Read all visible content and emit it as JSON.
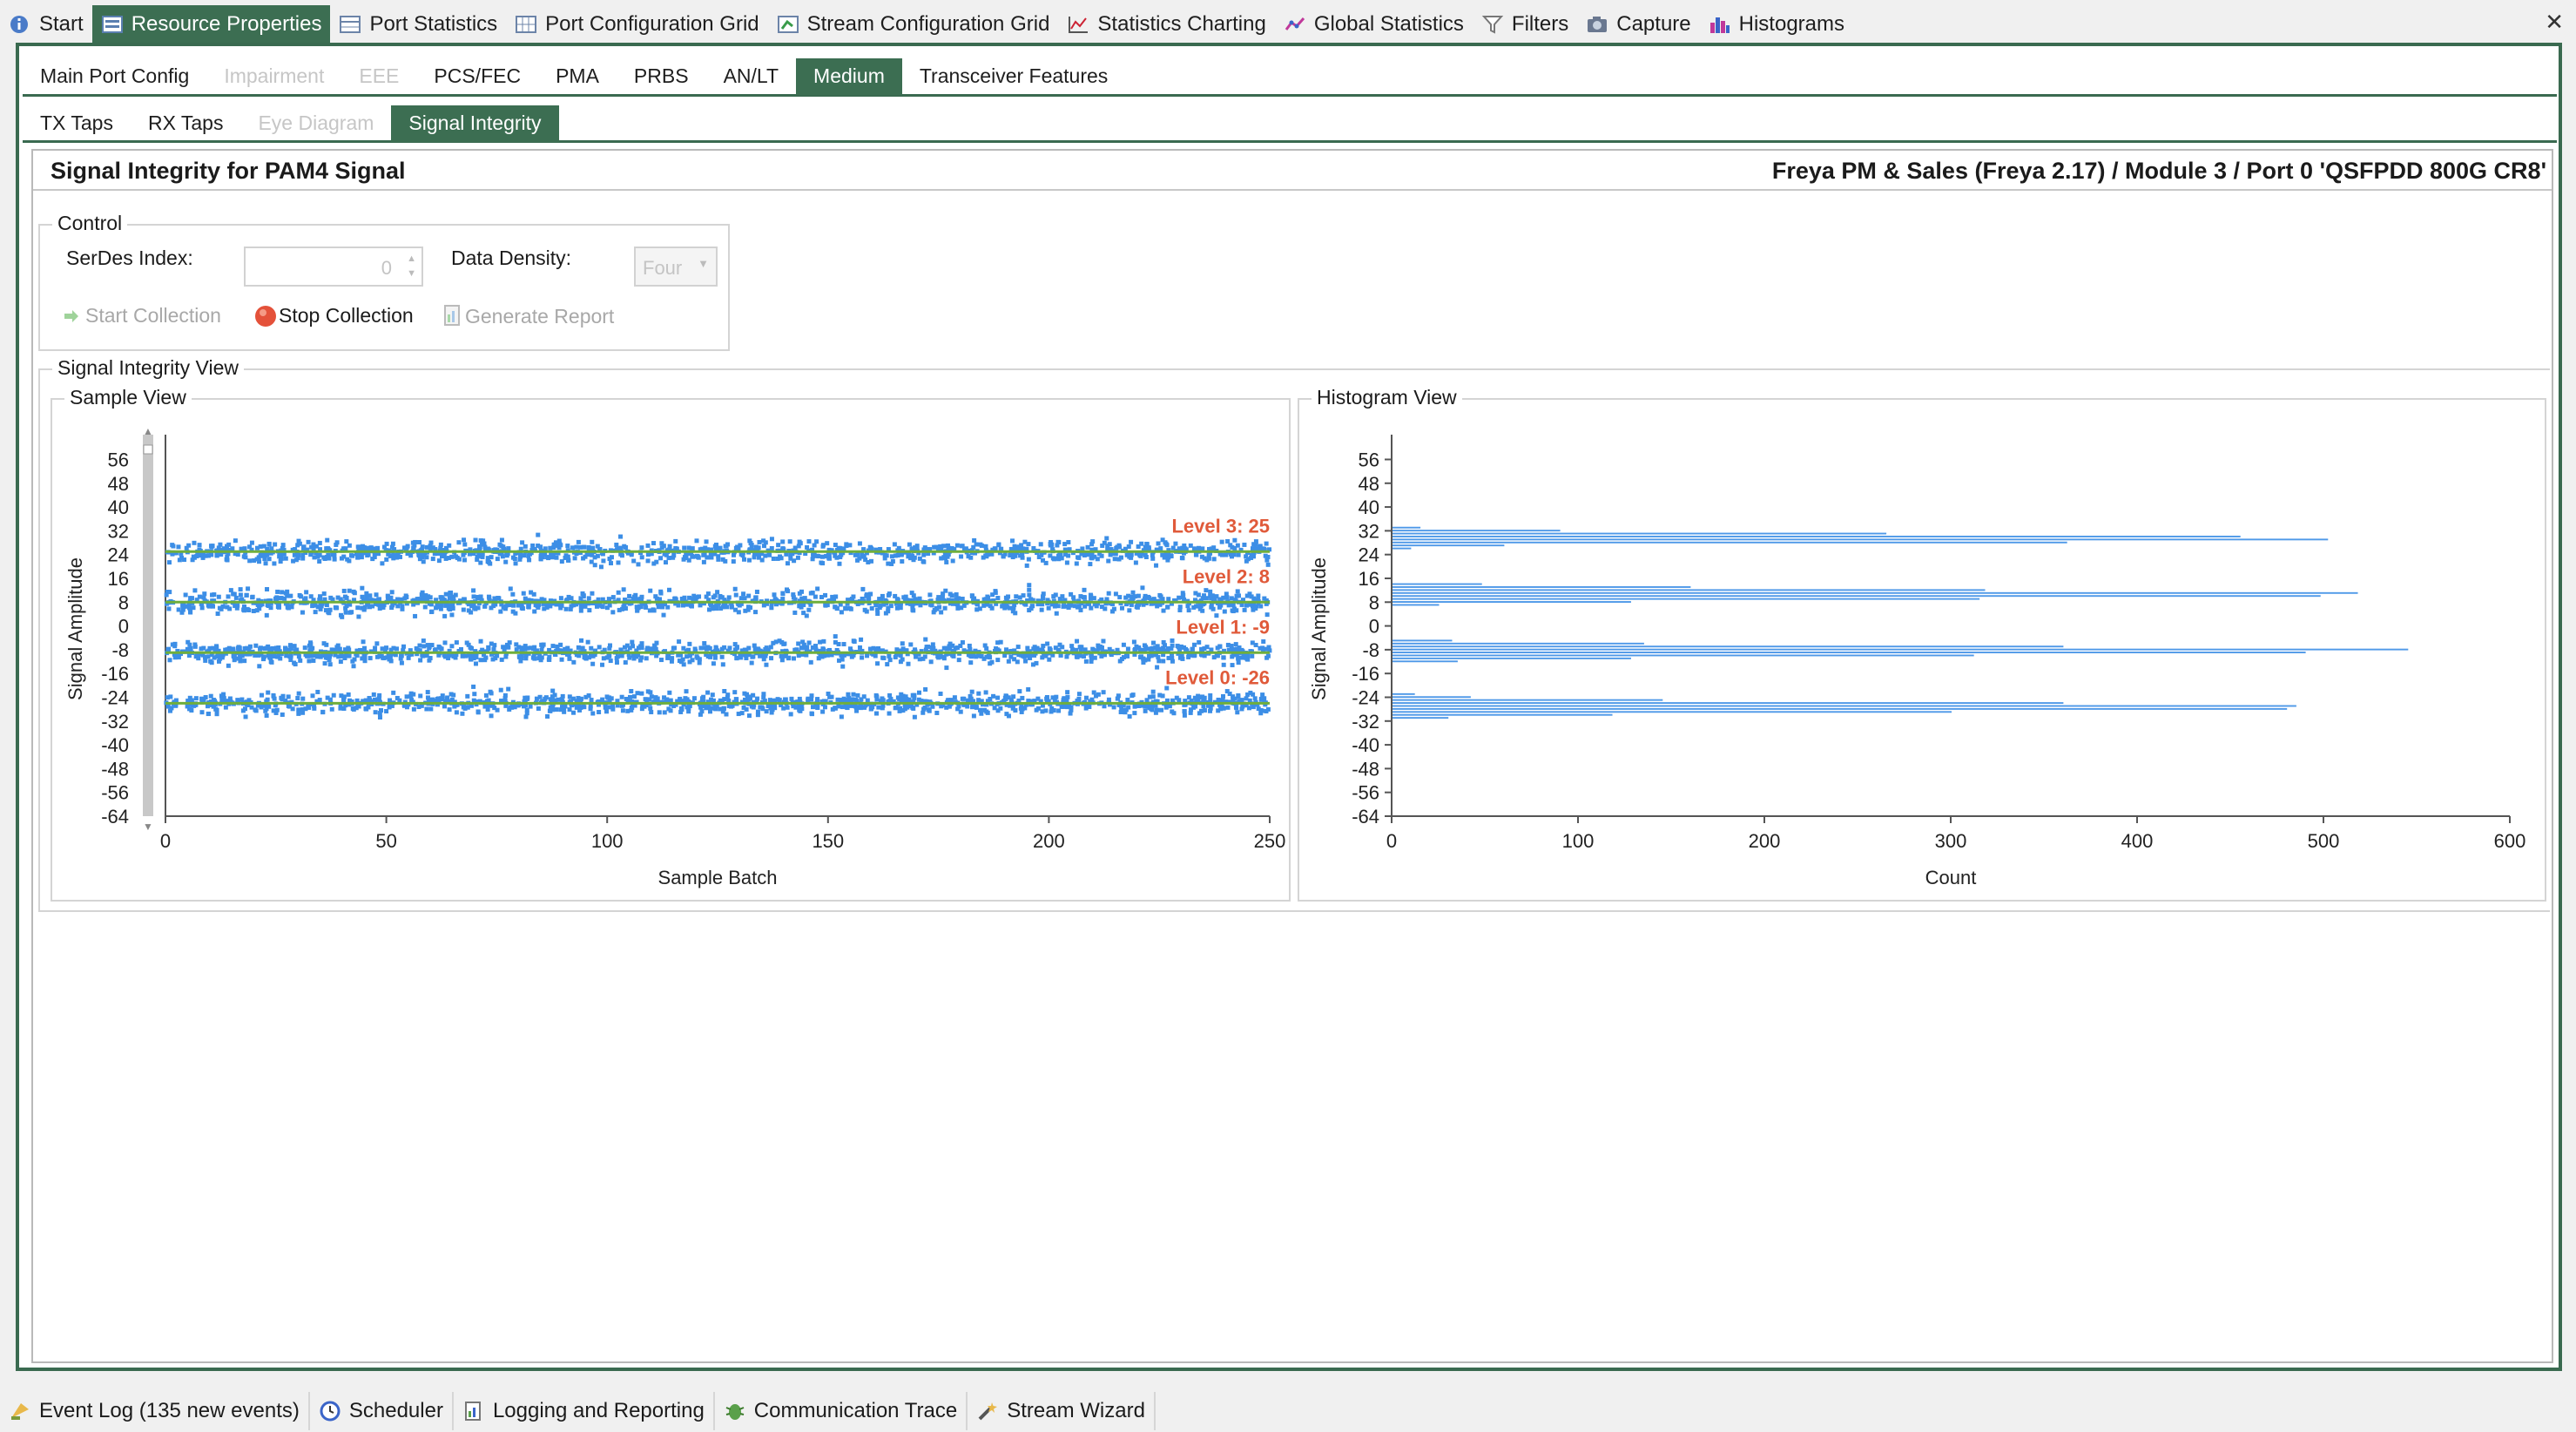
{
  "top_tabs": [
    {
      "label": "Start",
      "icon": "info-icon"
    },
    {
      "label": "Resource Properties",
      "icon": "properties-icon"
    },
    {
      "label": "Port Statistics",
      "icon": "table-icon"
    },
    {
      "label": "Port Configuration Grid",
      "icon": "grid-icon"
    },
    {
      "label": "Stream Configuration Grid",
      "icon": "stream-grid-icon"
    },
    {
      "label": "Statistics Charting",
      "icon": "chart-icon"
    },
    {
      "label": "Global Statistics",
      "icon": "global-stats-icon"
    },
    {
      "label": "Filters",
      "icon": "filter-icon"
    },
    {
      "label": "Capture",
      "icon": "camera-icon"
    },
    {
      "label": "Histograms",
      "icon": "histogram-icon"
    }
  ],
  "sub_tabs": [
    "Main Port Config",
    "Impairment",
    "EEE",
    "PCS/FEC",
    "PMA",
    "PRBS",
    "AN/LT",
    "Medium",
    "Transceiver Features"
  ],
  "medium_tabs": [
    "TX Taps",
    "RX Taps",
    "Eye Diagram",
    "Signal Integrity"
  ],
  "header": {
    "title": "Signal Integrity for PAM4 Signal",
    "port": "Freya PM & Sales (Freya 2.17) / Module 3 / Port 0 'QSFPDD 800G CR8'"
  },
  "control": {
    "group_title": "Control",
    "serdes_label": "SerDes Index:",
    "serdes_value": "0",
    "density_label": "Data Density:",
    "density_value": "Four",
    "start": "Start Collection",
    "stop": "Stop Collection",
    "report": "Generate Report"
  },
  "view": {
    "group_title": "Signal Integrity View",
    "sample_title": "Sample View",
    "histogram_title": "Histogram View"
  },
  "chart_data": [
    {
      "type": "scatter",
      "title": "Sample View",
      "xlabel": "Sample Batch",
      "ylabel": "Signal Amplitude",
      "xlim": [
        0,
        250
      ],
      "ylim": [
        -64,
        62
      ],
      "x_ticks": [
        0,
        50,
        100,
        150,
        200,
        250
      ],
      "y_ticks": [
        56,
        48,
        40,
        32,
        24,
        16,
        8,
        0,
        -8,
        -16,
        -24,
        -32,
        -40,
        -48,
        -56,
        -64
      ],
      "levels": [
        {
          "label": "Level 3: 25",
          "value": 25
        },
        {
          "label": "Level 2: 8",
          "value": 8
        },
        {
          "label": "Level 1: -9",
          "value": -9
        },
        {
          "label": "Level 0: -26",
          "value": -26
        }
      ],
      "series": [
        {
          "values_description": "dense samples clustered around each level",
          "spread": 4
        }
      ]
    },
    {
      "type": "bar",
      "title": "Histogram View",
      "xlabel": "Count",
      "ylabel": "Signal Amplitude",
      "xlim": [
        0,
        600
      ],
      "ylim": [
        -64,
        62
      ],
      "x_ticks": [
        0,
        100,
        200,
        300,
        400,
        500,
        600
      ],
      "y_ticks": [
        56,
        48,
        40,
        32,
        24,
        16,
        8,
        0,
        -8,
        -16,
        -24,
        -32,
        -40,
        -48,
        -56,
        -64
      ],
      "bars": [
        {
          "amplitude": 33,
          "count": 15
        },
        {
          "amplitude": 32,
          "count": 90
        },
        {
          "amplitude": 31,
          "count": 265
        },
        {
          "amplitude": 30,
          "count": 455
        },
        {
          "amplitude": 29,
          "count": 502
        },
        {
          "amplitude": 28,
          "count": 362
        },
        {
          "amplitude": 27,
          "count": 60
        },
        {
          "amplitude": 26,
          "count": 10
        },
        {
          "amplitude": 14,
          "count": 48
        },
        {
          "amplitude": 13,
          "count": 160
        },
        {
          "amplitude": 12,
          "count": 318
        },
        {
          "amplitude": 11,
          "count": 518
        },
        {
          "amplitude": 10,
          "count": 498
        },
        {
          "amplitude": 9,
          "count": 315
        },
        {
          "amplitude": 8,
          "count": 128
        },
        {
          "amplitude": 7,
          "count": 25
        },
        {
          "amplitude": -5,
          "count": 32
        },
        {
          "amplitude": -6,
          "count": 135
        },
        {
          "amplitude": -7,
          "count": 360
        },
        {
          "amplitude": -8,
          "count": 545
        },
        {
          "amplitude": -9,
          "count": 490
        },
        {
          "amplitude": -10,
          "count": 312
        },
        {
          "amplitude": -11,
          "count": 128
        },
        {
          "amplitude": -12,
          "count": 35
        },
        {
          "amplitude": -23,
          "count": 12
        },
        {
          "amplitude": -24,
          "count": 42
        },
        {
          "amplitude": -25,
          "count": 145
        },
        {
          "amplitude": -26,
          "count": 360
        },
        {
          "amplitude": -27,
          "count": 485
        },
        {
          "amplitude": -28,
          "count": 480
        },
        {
          "amplitude": -29,
          "count": 300
        },
        {
          "amplitude": -30,
          "count": 118
        },
        {
          "amplitude": -31,
          "count": 30
        }
      ]
    }
  ],
  "bottom_tabs": [
    {
      "label": "Event Log (135 new events)",
      "icon": "event-log-icon"
    },
    {
      "label": "Scheduler",
      "icon": "clock-icon"
    },
    {
      "label": "Logging and Reporting",
      "icon": "report-icon"
    },
    {
      "label": "Communication Trace",
      "icon": "bug-icon"
    },
    {
      "label": "Stream Wizard",
      "icon": "wand-icon"
    }
  ],
  "colors": {
    "accent": "#3c6e52",
    "point": "#3c8ee6",
    "level_line": "#6fae3c",
    "level_label": "#e05a3a",
    "bar": "#3c8ee6"
  }
}
